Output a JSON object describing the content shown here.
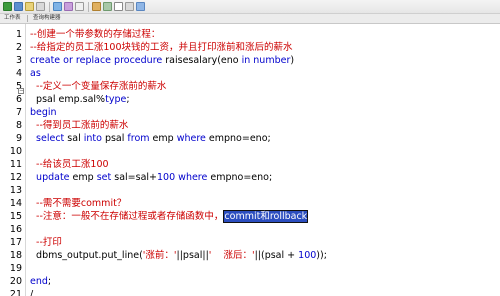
{
  "tabs": [
    {
      "label": "工作表"
    },
    {
      "label": "查询构建器"
    }
  ],
  "editor": {
    "lines": [
      {
        "num": "1",
        "segments": [
          {
            "t": "--创建一个带参数的存储过程：",
            "c": "cm"
          }
        ]
      },
      {
        "num": "2",
        "segments": [
          {
            "t": "--给指定的员工涨100块钱的工资，并且打印涨前和涨后的薪水",
            "c": "cm"
          }
        ]
      },
      {
        "num": "3",
        "segments": [
          {
            "t": "create or replace procedure",
            "c": "kw"
          },
          {
            "t": " raisesalary(eno ",
            "c": ""
          },
          {
            "t": "in number",
            "c": "kw"
          },
          {
            "t": ")",
            "c": ""
          }
        ]
      },
      {
        "num": "4",
        "segments": [
          {
            "t": "as",
            "c": "kw"
          }
        ]
      },
      {
        "num": "5",
        "segments": [
          {
            "t": "  --定义一个变量保存涨前的薪水",
            "c": "cm"
          }
        ]
      },
      {
        "num": "6",
        "segments": [
          {
            "t": "  psal emp.sal%",
            "c": ""
          },
          {
            "t": "type",
            "c": "kw"
          },
          {
            "t": ";",
            "c": ""
          }
        ]
      },
      {
        "num": "7",
        "segments": [
          {
            "t": "begin",
            "c": "kw"
          }
        ]
      },
      {
        "num": "8",
        "segments": [
          {
            "t": "  --得到员工涨前的薪水",
            "c": "cm"
          }
        ]
      },
      {
        "num": "9",
        "segments": [
          {
            "t": "  ",
            "c": ""
          },
          {
            "t": "select",
            "c": "kw"
          },
          {
            "t": " sal ",
            "c": ""
          },
          {
            "t": "into",
            "c": "kw"
          },
          {
            "t": " psal ",
            "c": ""
          },
          {
            "t": "from",
            "c": "kw"
          },
          {
            "t": " emp ",
            "c": ""
          },
          {
            "t": "where",
            "c": "kw"
          },
          {
            "t": " empno=eno;",
            "c": ""
          }
        ]
      },
      {
        "num": "10",
        "segments": []
      },
      {
        "num": "11",
        "segments": [
          {
            "t": "  --给该员工涨100",
            "c": "cm"
          }
        ]
      },
      {
        "num": "12",
        "segments": [
          {
            "t": "  ",
            "c": ""
          },
          {
            "t": "update",
            "c": "kw"
          },
          {
            "t": " emp ",
            "c": ""
          },
          {
            "t": "set",
            "c": "kw"
          },
          {
            "t": " sal=sal+",
            "c": ""
          },
          {
            "t": "100",
            "c": "num"
          },
          {
            "t": " ",
            "c": ""
          },
          {
            "t": "where",
            "c": "kw"
          },
          {
            "t": " empno=eno;",
            "c": ""
          }
        ]
      },
      {
        "num": "13",
        "segments": []
      },
      {
        "num": "14",
        "segments": [
          {
            "t": "  --需不需要commit？",
            "c": "cm"
          }
        ]
      },
      {
        "num": "15",
        "segments": [
          {
            "t": "  --注意：一般不在存储过程或者存储函数中，",
            "c": "cm"
          },
          {
            "t": "commit和rollback",
            "c": "sel"
          }
        ]
      },
      {
        "num": "16",
        "segments": []
      },
      {
        "num": "17",
        "segments": [
          {
            "t": "  --打印",
            "c": "cm"
          }
        ]
      },
      {
        "num": "18",
        "segments": [
          {
            "t": "  dbms_output.put_line(",
            "c": ""
          },
          {
            "t": "'涨前：'",
            "c": "str"
          },
          {
            "t": "||psal||",
            "c": ""
          },
          {
            "t": "'    涨后：'",
            "c": "str"
          },
          {
            "t": "||(psal + ",
            "c": ""
          },
          {
            "t": "100",
            "c": "num"
          },
          {
            "t": "));",
            "c": ""
          }
        ]
      },
      {
        "num": "19",
        "segments": []
      },
      {
        "num": "20",
        "segments": [
          {
            "t": "end",
            "c": "kw"
          },
          {
            "t": ";",
            "c": ""
          }
        ]
      },
      {
        "num": "21",
        "segments": [
          {
            "t": "/",
            "c": ""
          }
        ]
      }
    ]
  }
}
